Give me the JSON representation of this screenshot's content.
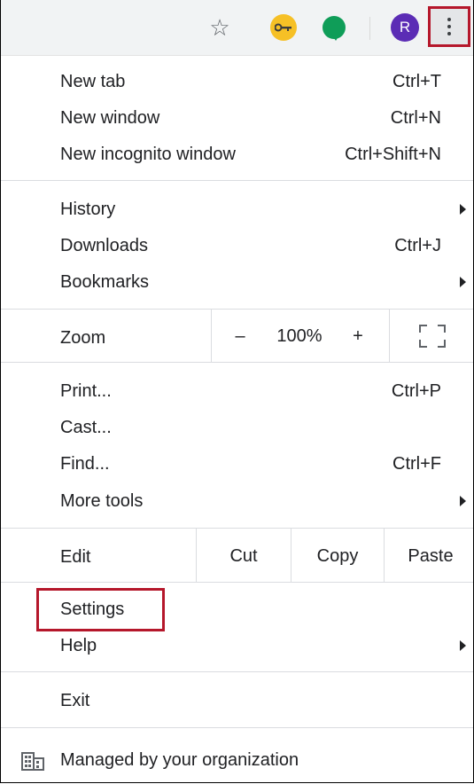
{
  "toolbar": {
    "star_icon": "☆",
    "avatar_initial": "R"
  },
  "menu": {
    "new_tab": {
      "label": "New tab",
      "shortcut": "Ctrl+T"
    },
    "new_window": {
      "label": "New window",
      "shortcut": "Ctrl+N"
    },
    "new_incognito": {
      "label": "New incognito window",
      "shortcut": "Ctrl+Shift+N"
    },
    "history": {
      "label": "History"
    },
    "downloads": {
      "label": "Downloads",
      "shortcut": "Ctrl+J"
    },
    "bookmarks": {
      "label": "Bookmarks"
    },
    "zoom": {
      "label": "Zoom",
      "minus": "–",
      "value": "100%",
      "plus": "+"
    },
    "print": {
      "label": "Print...",
      "shortcut": "Ctrl+P"
    },
    "cast": {
      "label": "Cast..."
    },
    "find": {
      "label": "Find...",
      "shortcut": "Ctrl+F"
    },
    "more_tools": {
      "label": "More tools"
    },
    "edit": {
      "label": "Edit",
      "cut": "Cut",
      "copy": "Copy",
      "paste": "Paste"
    },
    "settings": {
      "label": "Settings"
    },
    "help": {
      "label": "Help"
    },
    "exit": {
      "label": "Exit"
    },
    "managed": {
      "label": "Managed by your organization"
    }
  },
  "colors": {
    "highlight": "#b5172b",
    "avatar": "#5b2cb5",
    "key_ext": "#f6c026",
    "hangouts": "#0f9d58"
  }
}
